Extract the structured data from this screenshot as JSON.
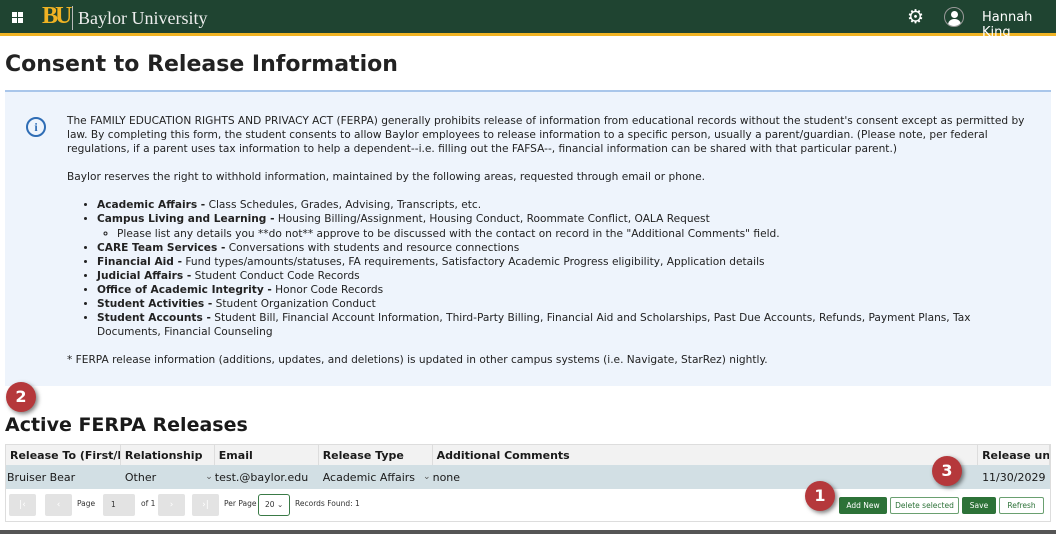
{
  "header": {
    "brand": "Baylor University",
    "logo": "BU",
    "user": "Hannah King",
    "icons": [
      "apps-grid-icon",
      "settings-gear-icon",
      "user-avatar-icon"
    ]
  },
  "page_title": "Consent to Release Information",
  "info": {
    "intro": "The FAMILY EDUCATION RIGHTS AND PRIVACY ACT (FERPA) generally prohibits release of information from educational records without the student's consent except as permitted by law. By completing this form, the student consents to allow Baylor employees to release information to a specific person, usually a parent/guardian. (Please note, per federal regulations, if a parent uses tax information to help a dependent--i.e. filling out the FAFSA--, financial information can be shared with that particular parent.)",
    "reserve": "Baylor reserves the right to withhold information, maintained by the following areas, requested through email or phone.",
    "areas": [
      {
        "name": "Academic Affairs -",
        "desc": " Class Schedules, Grades, Advising, Transcripts, etc."
      },
      {
        "name": "Campus Living and Learning -",
        "desc": " Housing Billing/Assignment, Housing Conduct, Roommate Conflict, OALA Request",
        "sub": "Please list any details you **do not** approve to be discussed with the contact on record in the \"Additional Comments\" field."
      },
      {
        "name": "CARE Team Services -",
        "desc": " Conversations with students and resource connections"
      },
      {
        "name": "Financial Aid -",
        "desc": " Fund types/amounts/statuses, FA requirements, Satisfactory Academic Progress eligibility, Application details"
      },
      {
        "name": "Judicial Affairs -",
        "desc": " Student Conduct Code Records"
      },
      {
        "name": "Office of Academic Integrity -",
        "desc": " Honor Code Records"
      },
      {
        "name": "Student Activities -",
        "desc": " Student Organization Conduct"
      },
      {
        "name": "Student Accounts -",
        "desc": " Student Bill, Financial Account Information, Third-Party Billing, Financial Aid and Scholarships, Past Due Accounts, Refunds, Payment Plans, Tax Documents, Financial Counseling"
      }
    ],
    "footnote": "* FERPA release information (additions, updates, and deletions) is updated in other campus systems (i.e. Navigate, StarRez) nightly."
  },
  "badges": [
    "1",
    "2",
    "3"
  ],
  "section_title": "Active FERPA Releases",
  "table": {
    "columns": [
      "Release To (First/L...",
      "Relationship",
      "Email",
      "Release Type",
      "Additional Comments",
      "Release un..."
    ],
    "rows": [
      [
        "Bruiser Bear",
        "Other",
        "test.@baylor.edu",
        "Academic Affairs",
        "none",
        "11/30/2029"
      ]
    ]
  },
  "pager": {
    "page_label": "Page",
    "page": "1",
    "of": "of 1",
    "per_page_label": "Per Page",
    "per_page": "20",
    "records": "Records Found: 1"
  },
  "buttons": {
    "add": "Add New",
    "delete": "Delete selected",
    "save": "Save",
    "refresh": "Refresh"
  }
}
